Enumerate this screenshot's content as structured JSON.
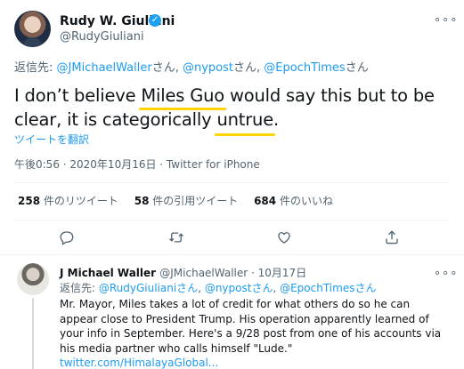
{
  "tweet": {
    "author_name": "Rudy W. Giuliani",
    "verified_mark": "✓",
    "author_handle": "@RudyGiuliani",
    "more_icon": "more-icon",
    "replying_prefix": "返信先: ",
    "replying_users": [
      "@JMichaelWaller",
      "@nypost",
      "@EpochTimes"
    ],
    "honorific": "さん",
    "separator": ", ",
    "text_part1": "I don’t believe ",
    "text_highlight1": "Miles Guo",
    "text_part2": " would say this but to be clear, it is categorically ",
    "text_highlight2": "untrue",
    "text_part3": ".",
    "translate_label": "ツイートを翻訳",
    "meta": "午後0:56 · 2020年10月16日 · Twitter for iPhone",
    "stats": [
      {
        "count": "258",
        "label": " 件のリツイート"
      },
      {
        "count": "58",
        "label": " 件の引用ツイート"
      },
      {
        "count": "684",
        "label": " 件のいいね"
      }
    ],
    "actions": [
      "reply-icon",
      "retweet-icon",
      "like-icon",
      "share-icon"
    ],
    "highlight_color": "#ffd400",
    "link_color": "#1d9bf0"
  },
  "reply": {
    "author_name": "J Michael Waller",
    "author_handle": "@JMichaelWaller",
    "date": "10月17日",
    "dot": " · ",
    "replying_prefix": "返信先: ",
    "replying_users": [
      "@RudyGiulianiさん",
      "@nypostさん",
      "@EpochTimesさん"
    ],
    "text": "Mr. Mayor, Miles takes a lot of credit for what others do so he can appear close to President Trump. His operation apparently learned of your info in September. Here's a 9/28 post from one of his accounts via his media partner who calls himself \"Lude.\" ",
    "link": "twitter.com/HimalayaGlobal..."
  }
}
